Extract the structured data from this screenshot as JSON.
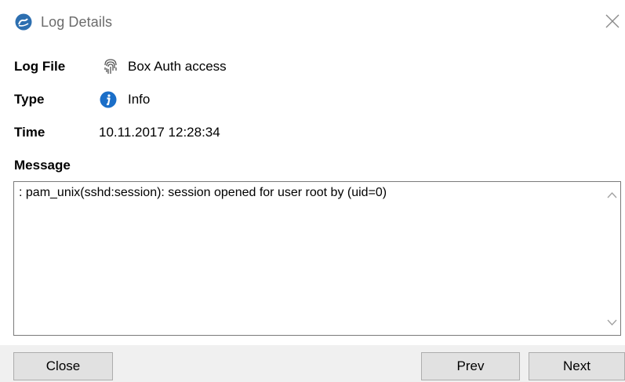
{
  "window": {
    "title": "Log Details",
    "close_icon": "close-icon",
    "app_icon": "app-logo-icon"
  },
  "fields": {
    "log_file": {
      "label": "Log File",
      "value": "Box Auth access",
      "icon": "fingerprint-icon"
    },
    "type": {
      "label": "Type",
      "value": "Info",
      "icon": "info-icon"
    },
    "time": {
      "label": "Time",
      "value": "10.11.2017 12:28:34"
    }
  },
  "message": {
    "label": "Message",
    "text": ": pam_unix(sshd:session): session opened for user root by (uid=0)"
  },
  "buttons": {
    "close": "Close",
    "prev": "Prev",
    "next": "Next"
  },
  "colors": {
    "info_blue": "#1a6ec8",
    "footer_bg": "#f0f0f0",
    "button_bg": "#e1e1e1"
  }
}
